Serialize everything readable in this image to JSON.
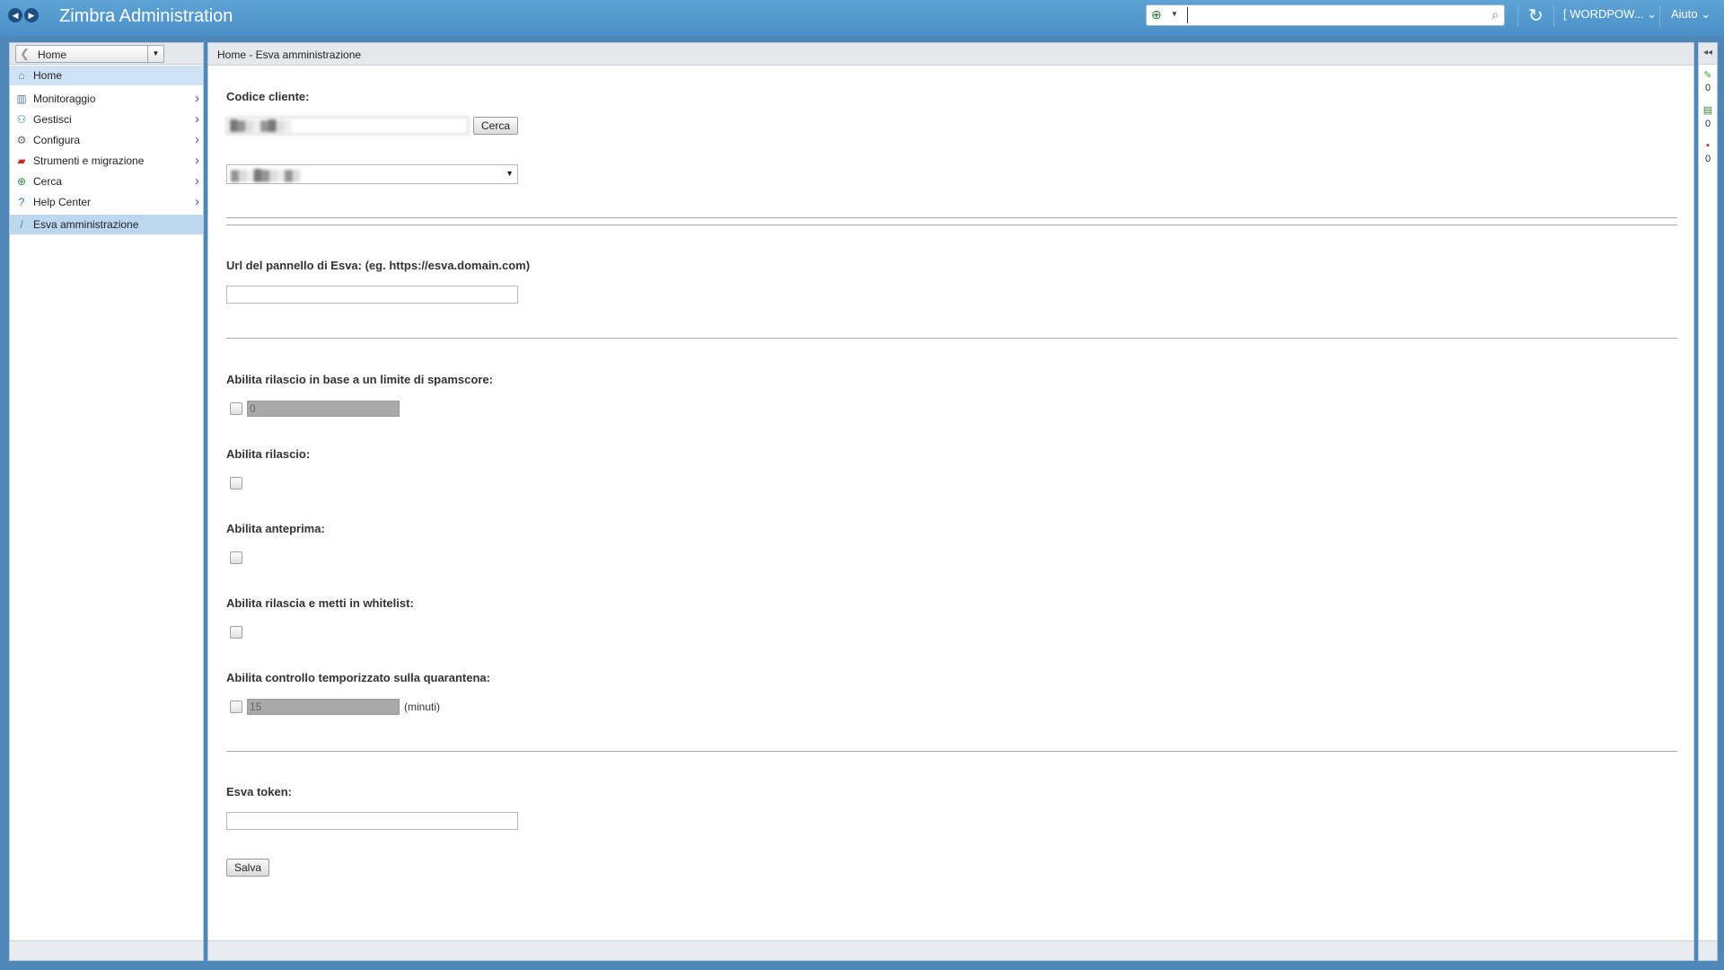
{
  "app": {
    "title": "Zimbra Administration"
  },
  "topbar": {
    "back_icon": "◀",
    "forward_icon": "▶",
    "search_scope_icon": "⊕",
    "search_placeholder": "",
    "search_go_icon": "⌕",
    "refresh_icon": "↻",
    "user_label": "[ WORDPOW...  ⌄",
    "help_label": "Aiuto  ⌄"
  },
  "sidebar": {
    "home_select": "Home",
    "items": [
      {
        "label": "Home",
        "icon": "⌂",
        "icon_color": "#777777",
        "has_children": false
      },
      {
        "label": "Monitoraggio",
        "icon": "▥",
        "icon_color": "#5b7aa8",
        "has_children": true
      },
      {
        "label": "Gestisci",
        "icon": "⚇",
        "icon_color": "#3b78c4",
        "has_children": true
      },
      {
        "label": "Configura",
        "icon": "⚙",
        "icon_color": "#666666",
        "has_children": true
      },
      {
        "label": "Strumenti e migrazione",
        "icon": "▰",
        "icon_color": "#c4302b",
        "has_children": true
      },
      {
        "label": "Cerca",
        "icon": "⊕",
        "icon_color": "#2a8a4a",
        "has_children": true
      },
      {
        "label": "Help Center",
        "icon": "?",
        "icon_color": "#1f6fc4",
        "has_children": true
      },
      {
        "label": "Esva amministrazione",
        "icon": "/",
        "icon_color": "#3a9a3a",
        "has_children": false
      }
    ]
  },
  "main": {
    "breadcrumb": "Home - Esva amministrazione",
    "customer_code_label": "Codice cliente:",
    "customer_code_value": "█▓▒░▓█▒░",
    "search_button": "Cerca",
    "customer_select_value": "▓▒░█▓▒░▓▒",
    "panel_url_label": "Url del pannello di Esva: (eg. https://esva.domain.com)",
    "panel_url_value": "",
    "spamscore_label": "Abilita rilascio in base a un limite di spamscore:",
    "spamscore_value": "0",
    "release_label": "Abilita rilascio:",
    "preview_label": "Abilita anteprima:",
    "whitelist_label": "Abilita rilascia e metti in whitelist:",
    "timed_label": "Abilita controllo temporizzato sulla quarantena:",
    "timed_value": "15",
    "timed_unit": "(minuti)",
    "token_label": "Esva token:",
    "token_value": "",
    "save_button": "Salva"
  },
  "right_strip": {
    "collapse_icon": "◂◂",
    "counters": [
      {
        "icon": "✎",
        "icon_color": "#3a9a3a",
        "count": "0"
      },
      {
        "icon": "▤",
        "icon_color": "#3a7a3a",
        "count": "0"
      },
      {
        "icon": "▪",
        "icon_color": "#c4302b",
        "count": "0"
      }
    ]
  }
}
